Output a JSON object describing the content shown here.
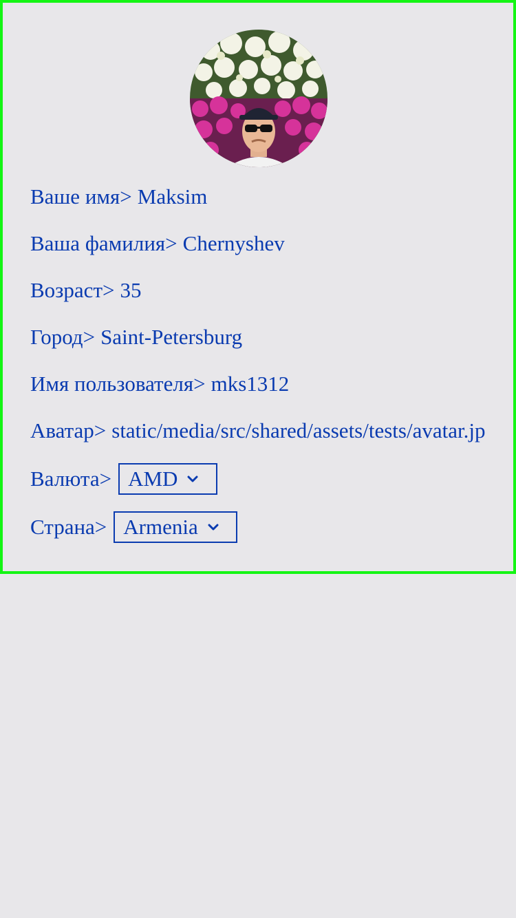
{
  "profile": {
    "avatar_alt": "avatar",
    "first_name": {
      "label": "Ваше имя>",
      "value": "Maksim"
    },
    "last_name": {
      "label": "Ваша фамилия>",
      "value": "Chernyshev"
    },
    "age": {
      "label": "Возраст>",
      "value": "35"
    },
    "city": {
      "label": "Город>",
      "value": "Saint-Petersburg"
    },
    "username": {
      "label": "Имя пользователя>",
      "value": "mks1312"
    },
    "avatar": {
      "label": "Аватар>",
      "value": "static/media/src/shared/assets/tests/avatar.jpg"
    },
    "currency": {
      "label": "Валюта>",
      "selected": "AMD"
    },
    "country": {
      "label": "Страна>",
      "selected": "Armenia"
    }
  },
  "colors": {
    "text": "#0a3bb0",
    "border": "#14f514",
    "background": "#e8e7ea"
  }
}
